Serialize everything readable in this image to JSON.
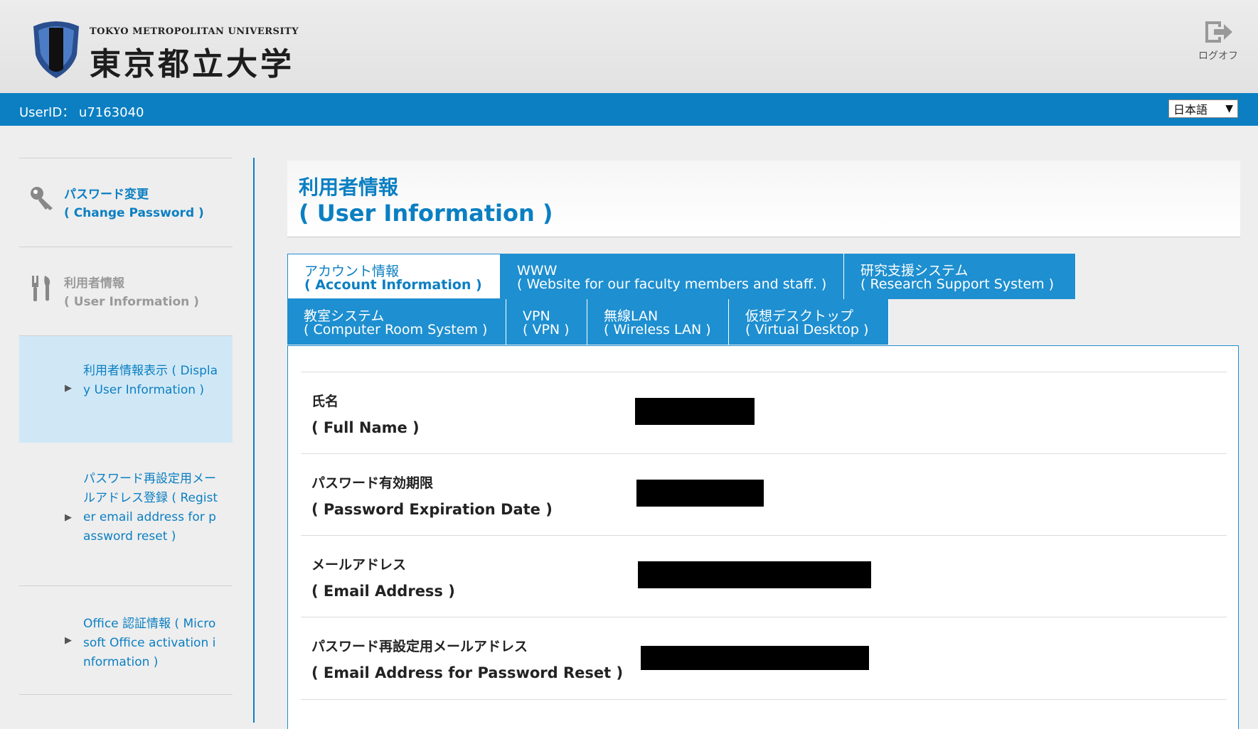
{
  "header": {
    "logo_en": "TOKYO METROPOLITAN UNIVERSITY",
    "logo_jp": "東京都立大学",
    "logout_label": "ログオフ"
  },
  "userbar": {
    "user_id": "UserID： u7163040",
    "language": "日本語"
  },
  "sidebar": {
    "items": [
      {
        "label_jp": "パスワード変更",
        "label_en": "( Change Password )",
        "icon": "key-icon"
      },
      {
        "label_jp": "利用者情報",
        "label_en": "( User Information )",
        "icon": "tools-icon"
      }
    ],
    "subitems": [
      {
        "label": "利用者情報表示 ( Display User Information )",
        "selected": true
      },
      {
        "label": "パスワード再設定用メールアドレス登録 ( Register email address for password reset )",
        "selected": false
      },
      {
        "label": "Office 認証情報 ( Microsoft Office activation information )",
        "selected": false
      }
    ]
  },
  "main": {
    "title_jp": "利用者情報",
    "title_en": "( User Information )",
    "tabs": [
      {
        "l1": "アカウント情報",
        "l2": "( Account Information )",
        "active": true
      },
      {
        "l1": "WWW",
        "l2": "( Website for our faculty members and staff. )",
        "active": false
      },
      {
        "l1": "研究支援システム",
        "l2": "( Research Support System )",
        "active": false
      },
      {
        "l1": "教室システム",
        "l2": "( Computer Room System )",
        "active": false
      },
      {
        "l1": "VPN",
        "l2": "( VPN )",
        "active": false
      },
      {
        "l1": "無線LAN",
        "l2": "( Wireless LAN )",
        "active": false
      },
      {
        "l1": "仮想デスクトップ",
        "l2": "( Virtual Desktop )",
        "active": false
      }
    ],
    "fields": [
      {
        "label_jp": "氏名",
        "label_en": "( Full Name )"
      },
      {
        "label_jp": "パスワード有効期限",
        "label_en": "( Password Expiration Date )"
      },
      {
        "label_jp": "メールアドレス",
        "label_en": "( Email Address )"
      },
      {
        "label_jp": "パスワード再設定用メールアドレス",
        "label_en": "( Email Address for Password Reset )"
      }
    ]
  },
  "colors": {
    "accent": "#0b7fc2",
    "tab": "#1e8fd0",
    "selected_bg": "#d0e8f6"
  }
}
